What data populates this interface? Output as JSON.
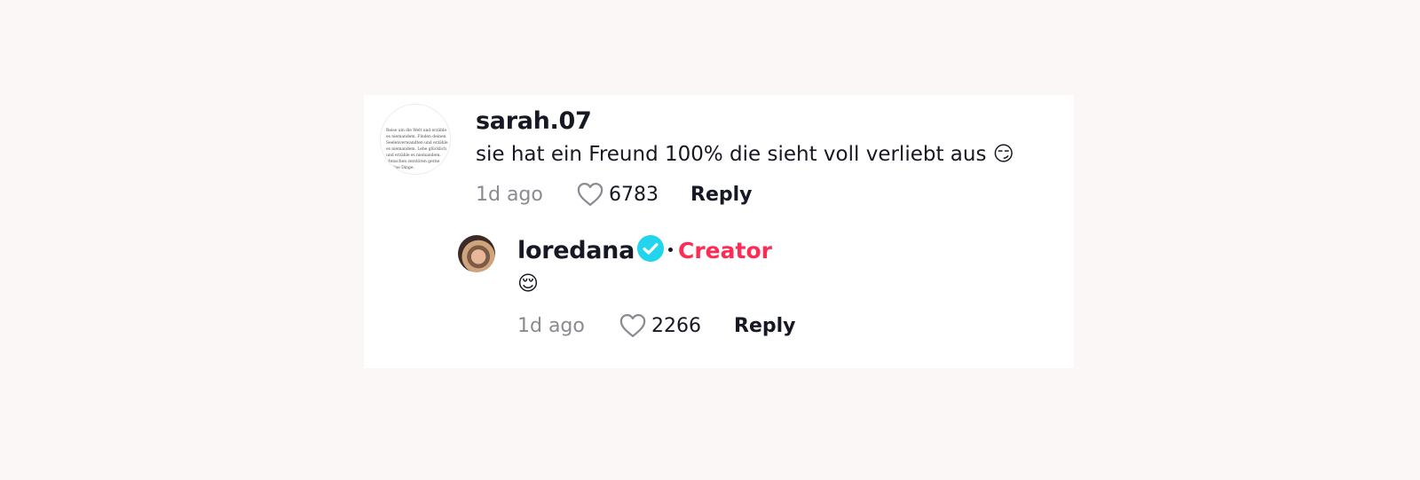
{
  "comments": [
    {
      "username": "sarah.07",
      "text": "sie hat ein Freund 100% die sieht voll verliebt aus",
      "emoji": "😏",
      "time": "1d ago",
      "likes": "6783",
      "reply_label": "Reply",
      "avatar_text": "Reise um die Welt und erzähle es niemandem. Finden deinen Seelenverwandten und erzähle es niemandem. Lebe glücklich und erzähle es niemandem. Menschen zerstören gerne schöne Dinge."
    }
  ],
  "reply": {
    "username": "loredana",
    "badge": "Creator",
    "emoji": "😌",
    "time": "1d ago",
    "likes": "2266",
    "reply_label": "Reply"
  },
  "colors": {
    "background": "#faf7f6",
    "card": "#ffffff",
    "text": "#161823",
    "muted": "#8a8b91",
    "creator": "#fe2c55",
    "verified": "#20d5ec"
  },
  "icons": {
    "like": "heart-outline-icon",
    "verified": "verified-badge-icon"
  }
}
